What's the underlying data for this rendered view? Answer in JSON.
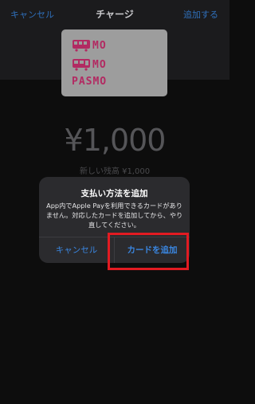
{
  "nav": {
    "cancel": "キャンセル",
    "title": "チャージ",
    "add": "追加する"
  },
  "card": {
    "line1": "MO",
    "line2": "MO",
    "brand": "PASMO",
    "brand_color": "#b22a62"
  },
  "charge": {
    "amount": "¥1,000",
    "new_balance": "新しい残高 ¥1,000"
  },
  "alert": {
    "title": "支払い方法を追加",
    "message": "App内でApple Payを利用できるカードがありません。対応したカードを追加してから、やり直してください。",
    "cancel": "キャンセル",
    "add_card": "カードを追加"
  },
  "colors": {
    "accent_blue": "#3a86e0",
    "highlight_red": "#e21b22"
  }
}
